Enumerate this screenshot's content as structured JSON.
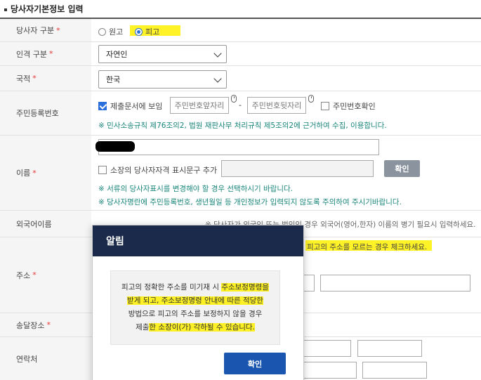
{
  "section": {
    "title": "당사자기본정보 입력"
  },
  "party_type": {
    "label": "당사자 구분",
    "req": "*",
    "options": [
      {
        "label": "원고",
        "selected": false
      },
      {
        "label": "피고",
        "selected": true
      }
    ]
  },
  "person_type": {
    "label": "인격 구분",
    "req": "*",
    "value": "자연인"
  },
  "nationality": {
    "label": "국적",
    "req": "*",
    "value": "한국"
  },
  "resident_no": {
    "label": "주민등록번호",
    "submit_check_label": "제출문서에 보임",
    "submit_check_checked": true,
    "front_placeholder": "주민번호앞자리",
    "dash": "-",
    "back_placeholder": "주민번호뒷자리",
    "confirm_check_label": "주민번호확인",
    "note": "※ 민사소송규칙 제76조의2, 법원 재판사무 처리규칙 제5조의2에 근거하여 수집, 이용합니다."
  },
  "name": {
    "label": "이름",
    "req": "*",
    "check_label": "소장의 당사자자격 표시문구 추가",
    "confirm_button": "확인",
    "note1": "※ 서류의 당사자표시를 변경해야 할 경우 선택하시기 바랍니다.",
    "note2": "※ 당사자명란에 주민등록번호, 생년월일 등 개인정보가 입력되지 않도록 주의하여 주시기바랍니다."
  },
  "foreign_name": {
    "label": "외국어이름",
    "note": "※ 당사자가 외국인 또는 법인인 경우 외국어(영어,한자) 이름의 병기 필요시 입력하세요."
  },
  "address": {
    "label": "주소",
    "req": "*",
    "unknown_note": "피고의 주소를 모르는 경우 체크하세요."
  },
  "delivery": {
    "label": "송달장소",
    "req": "*"
  },
  "contact": {
    "label": "연락처"
  },
  "modal": {
    "title": "알림",
    "line1_a": "피고의 정확한 주소를 미기재 시 ",
    "line1_b": "주소보정명령을",
    "line2": "받게 되고, 주소보정명령 안내에 따른 적당한",
    "line3": "방법으로 피고의 주소를 보정하지 않을 경우",
    "line4_a": "제출",
    "line4_b": "한 소장이(가) 각하될 수 있습니다.",
    "confirm": "확인"
  },
  "colors": {
    "highlight": "#fff000",
    "accent": "#2a6fdb",
    "note": "#18857a",
    "modal_header": "#1b2a4a",
    "modal_button": "#1a56b0"
  }
}
